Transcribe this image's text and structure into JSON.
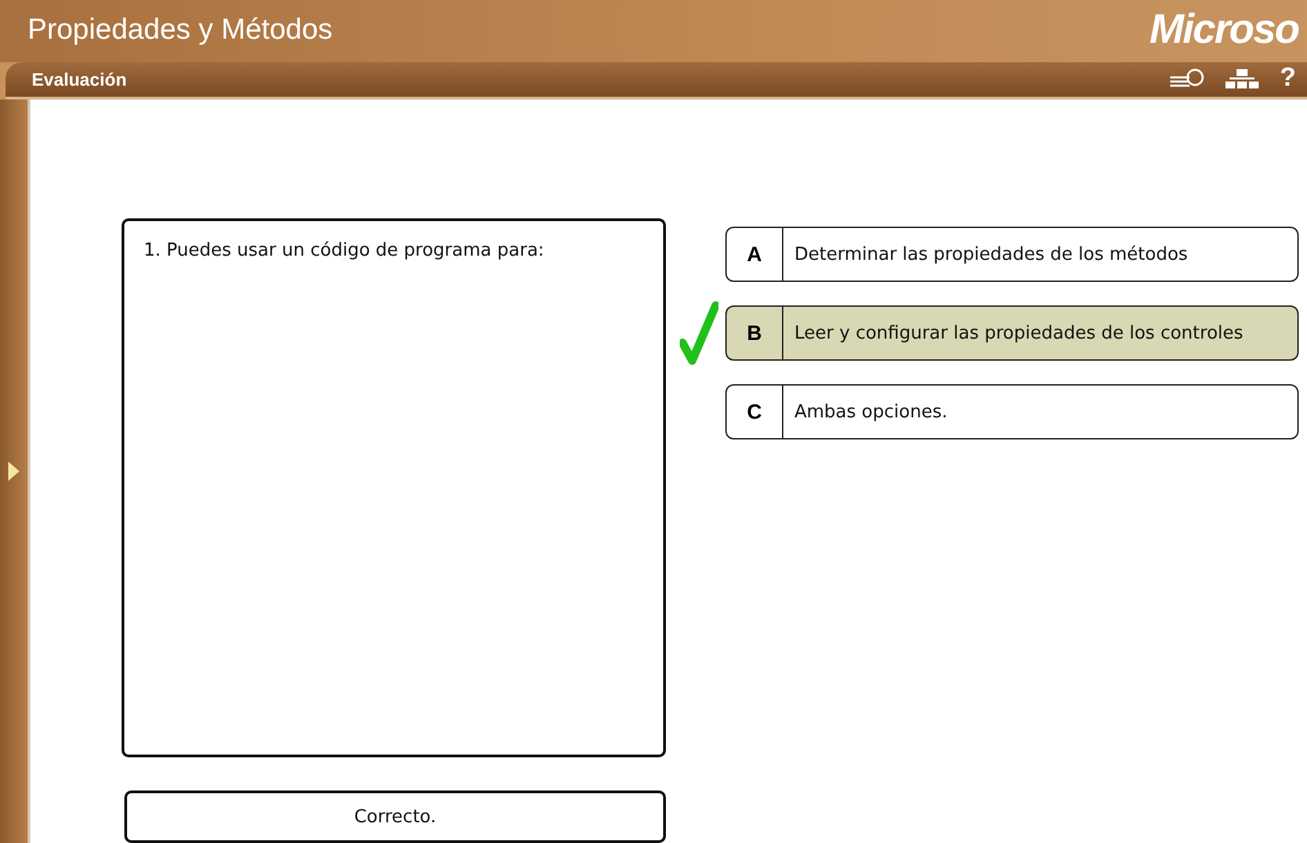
{
  "header": {
    "title": "Propiedades y Métodos",
    "logo": "Microso"
  },
  "toolbar": {
    "title": "Evaluación",
    "help": "?"
  },
  "question": {
    "text": "1. Puedes usar un código de programa para:"
  },
  "options": [
    {
      "letter": "A",
      "text": "Determinar las propiedades de los métodos",
      "selected": false
    },
    {
      "letter": "B",
      "text": "Leer y configurar las propiedades de los controles",
      "selected": true
    },
    {
      "letter": "C",
      "text": "Ambas opciones.",
      "selected": false
    }
  ],
  "feedback": "Correcto."
}
